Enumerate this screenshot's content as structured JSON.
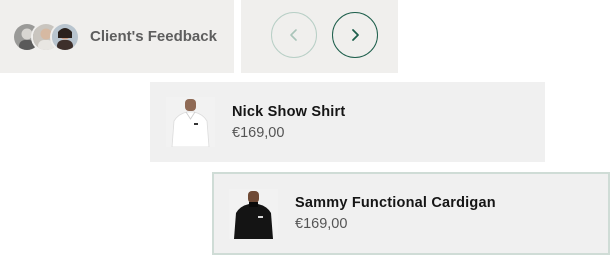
{
  "feedback": {
    "label": "Client's Feedback",
    "avatars": [
      "avatar-1",
      "avatar-2",
      "avatar-3"
    ]
  },
  "navigation": {
    "prev_icon": "chevron-left-icon",
    "next_icon": "chevron-right-icon"
  },
  "products": [
    {
      "name": "Nick Show Shirt",
      "price": "€169,00",
      "image": "white-polo-shirt"
    },
    {
      "name": "Sammy Functional Cardigan",
      "price": "€169,00",
      "image": "black-cardigan"
    }
  ],
  "colors": {
    "panel_bg": "#f0efed",
    "card_bg": "#f0f0f0",
    "accent_green": "#1d5e4b",
    "muted_green": "#b8cfc6",
    "selected_border": "#cfdcd6"
  }
}
